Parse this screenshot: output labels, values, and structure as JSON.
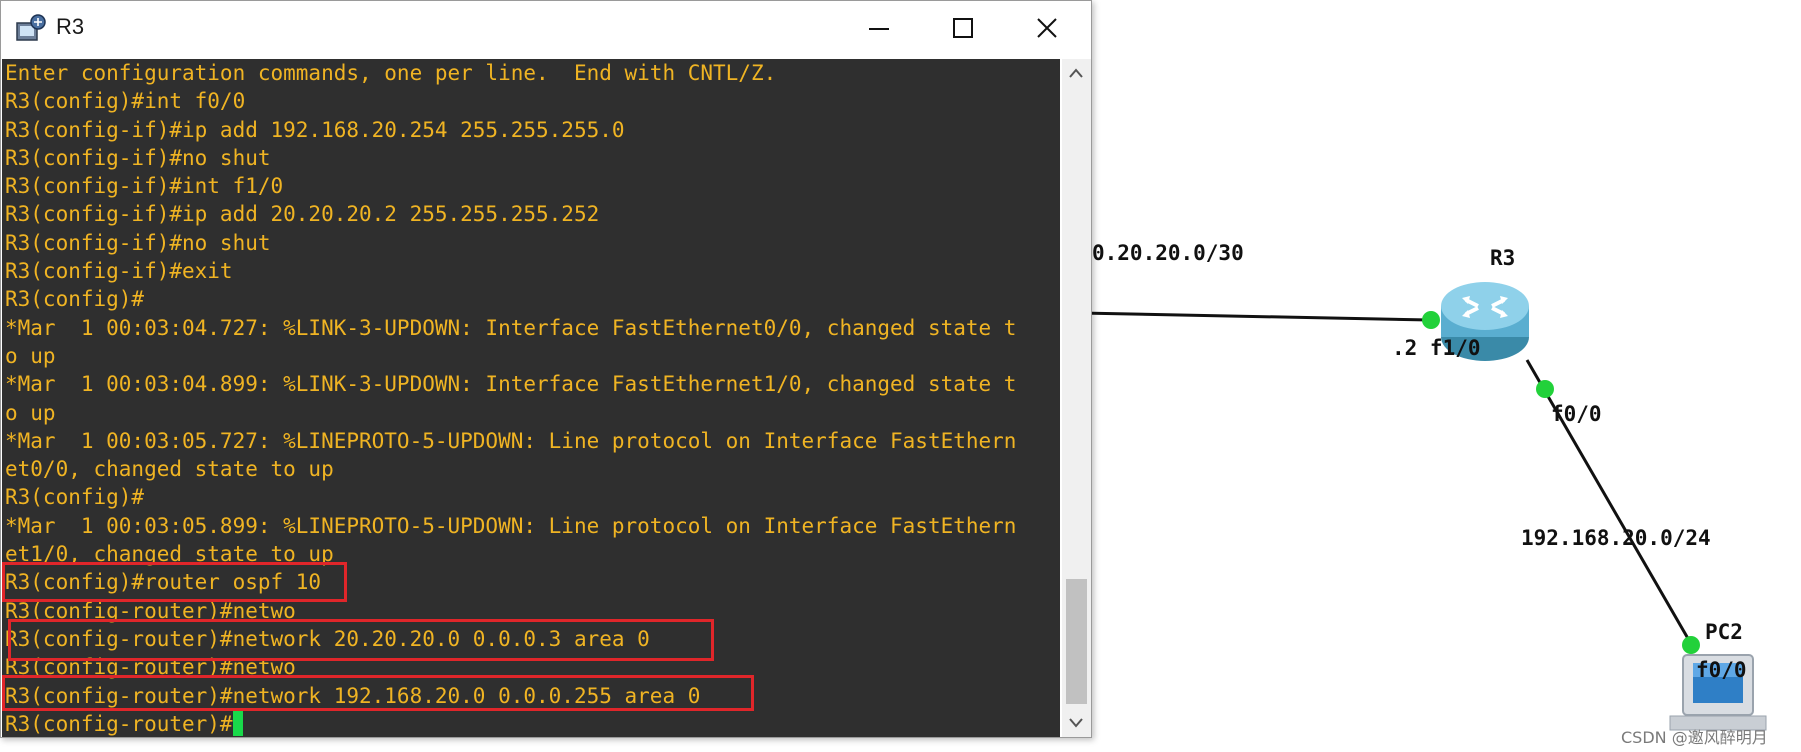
{
  "window": {
    "title": "R3",
    "icon": "router-console-icon",
    "controls": {
      "minimize": "minimize-icon",
      "maximize": "maximize-icon",
      "close": "close-icon"
    }
  },
  "terminal": {
    "text_color": "#f0b423",
    "background": "#2f2f2f",
    "lines": [
      "Enter configuration commands, one per line.  End with CNTL/Z.",
      "R3(config)#int f0/0",
      "R3(config-if)#ip add 192.168.20.254 255.255.255.0",
      "R3(config-if)#no shut",
      "R3(config-if)#int f1/0",
      "R3(config-if)#ip add 20.20.20.2 255.255.255.252",
      "R3(config-if)#no shut",
      "R3(config-if)#exit",
      "R3(config)#",
      "*Mar  1 00:03:04.727: %LINK-3-UPDOWN: Interface FastEthernet0/0, changed state t",
      "o up",
      "*Mar  1 00:03:04.899: %LINK-3-UPDOWN: Interface FastEthernet1/0, changed state t",
      "o up",
      "*Mar  1 00:03:05.727: %LINEPROTO-5-UPDOWN: Line protocol on Interface FastEthern",
      "et0/0, changed state to up",
      "R3(config)#",
      "*Mar  1 00:03:05.899: %LINEPROTO-5-UPDOWN: Line protocol on Interface FastEthern",
      "et1/0, changed state to up",
      "R3(config)#router ospf 10",
      "R3(config-router)#netwo",
      "R3(config-router)#network 20.20.20.0 0.0.0.3 area 0",
      "R3(config-router)#netwo",
      "R3(config-router)#network 192.168.20.0 0.0.0.255 area 0",
      "R3(config-router)#"
    ],
    "highlight_color": "#e0262a",
    "cursor_color": "#19d94a"
  },
  "topology": {
    "link_label_left": "0.20.20.0/30",
    "router_name": "R3",
    "router_if_left": ".2 f1/0",
    "router_if_down": "f0/0",
    "link_label_down": "192.168.20.0/24",
    "pc_name": "PC2",
    "pc_if": "f0/0",
    "port_color": "#22d13a"
  },
  "watermark": "CSDN @邀风醉明月"
}
